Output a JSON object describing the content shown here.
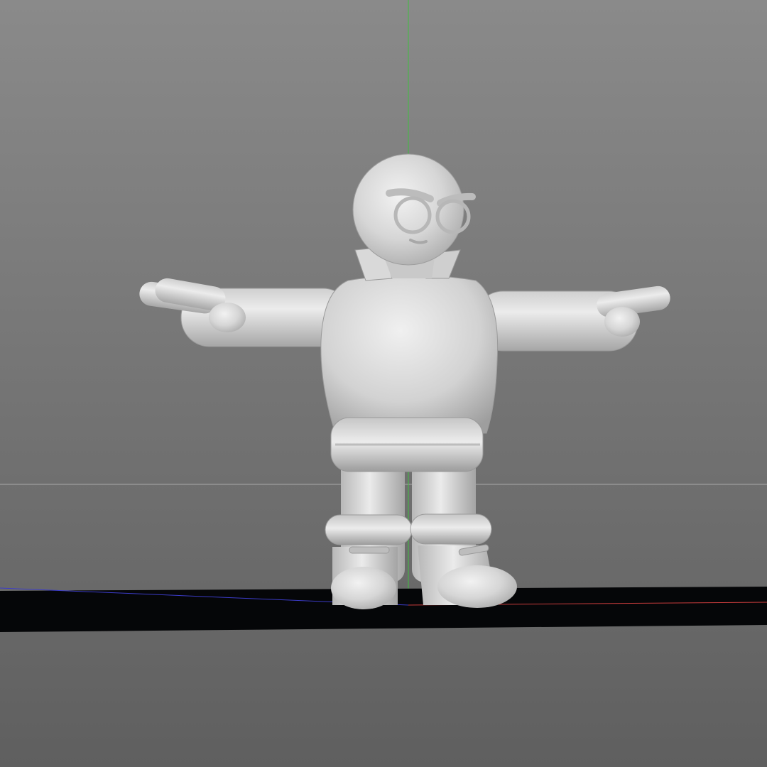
{
  "viewport": {
    "background_top": "#8a8a8a",
    "background_bottom": "#606060",
    "axis_y_color": "#3fbf3f",
    "axis_x_color": "#c83c3c",
    "axis_z_color": "#3c3cc8",
    "horizon_line_color": "#a8a8a8",
    "ground_plane_color": "#050608",
    "model_color": "#d4d4d4"
  },
  "scene": {
    "model": "character-t-pose",
    "icons": [
      "world-axis-y",
      "world-axis-x",
      "world-axis-z"
    ]
  }
}
